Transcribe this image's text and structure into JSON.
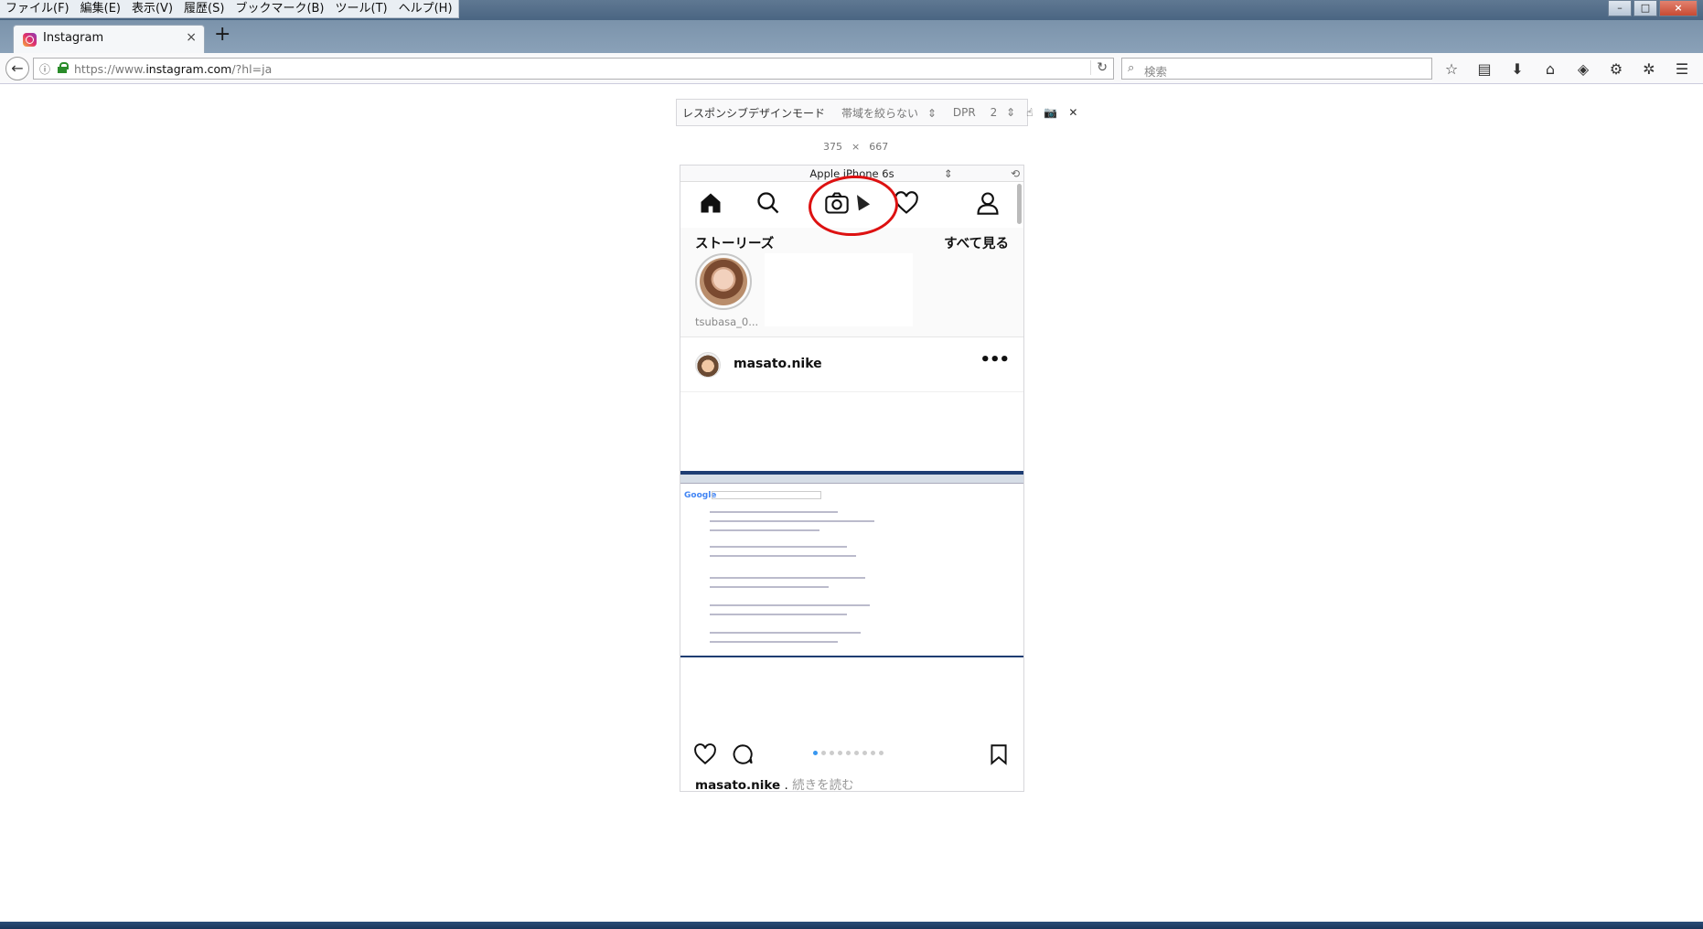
{
  "menu": [
    "ファイル(F)",
    "編集(E)",
    "表示(V)",
    "履歴(S)",
    "ブックマーク(B)",
    "ツール(T)",
    "ヘルプ(H)"
  ],
  "tab": {
    "title": "Instagram",
    "close": "×",
    "new": "+"
  },
  "nav": {
    "url_prefix": "https://www.",
    "url_host": "instagram.com",
    "url_path": "/?hl=ja",
    "search_placeholder": "検索"
  },
  "rdm": {
    "mode_label": "レスポンシブデザインモード",
    "throttle": "帯域を絞らない",
    "dpr_label": "DPR",
    "dpr_value": "2",
    "width": "375",
    "times": "×",
    "height": "667",
    "device": "Apple iPhone 6s"
  },
  "instagram": {
    "stories_title": "ストーリーズ",
    "see_all": "すべて見る",
    "story_user": "tsubasa_0...",
    "post_user": "masato.nike",
    "more_button": "•••",
    "caption_user": "masato.nike",
    "caption_sep": " . ",
    "caption_more": "続きを読む",
    "carousel_count": 9,
    "carousel_index": 1
  },
  "colors": {
    "annotation": "#dd1111",
    "carousel_active": "#3897f0"
  }
}
